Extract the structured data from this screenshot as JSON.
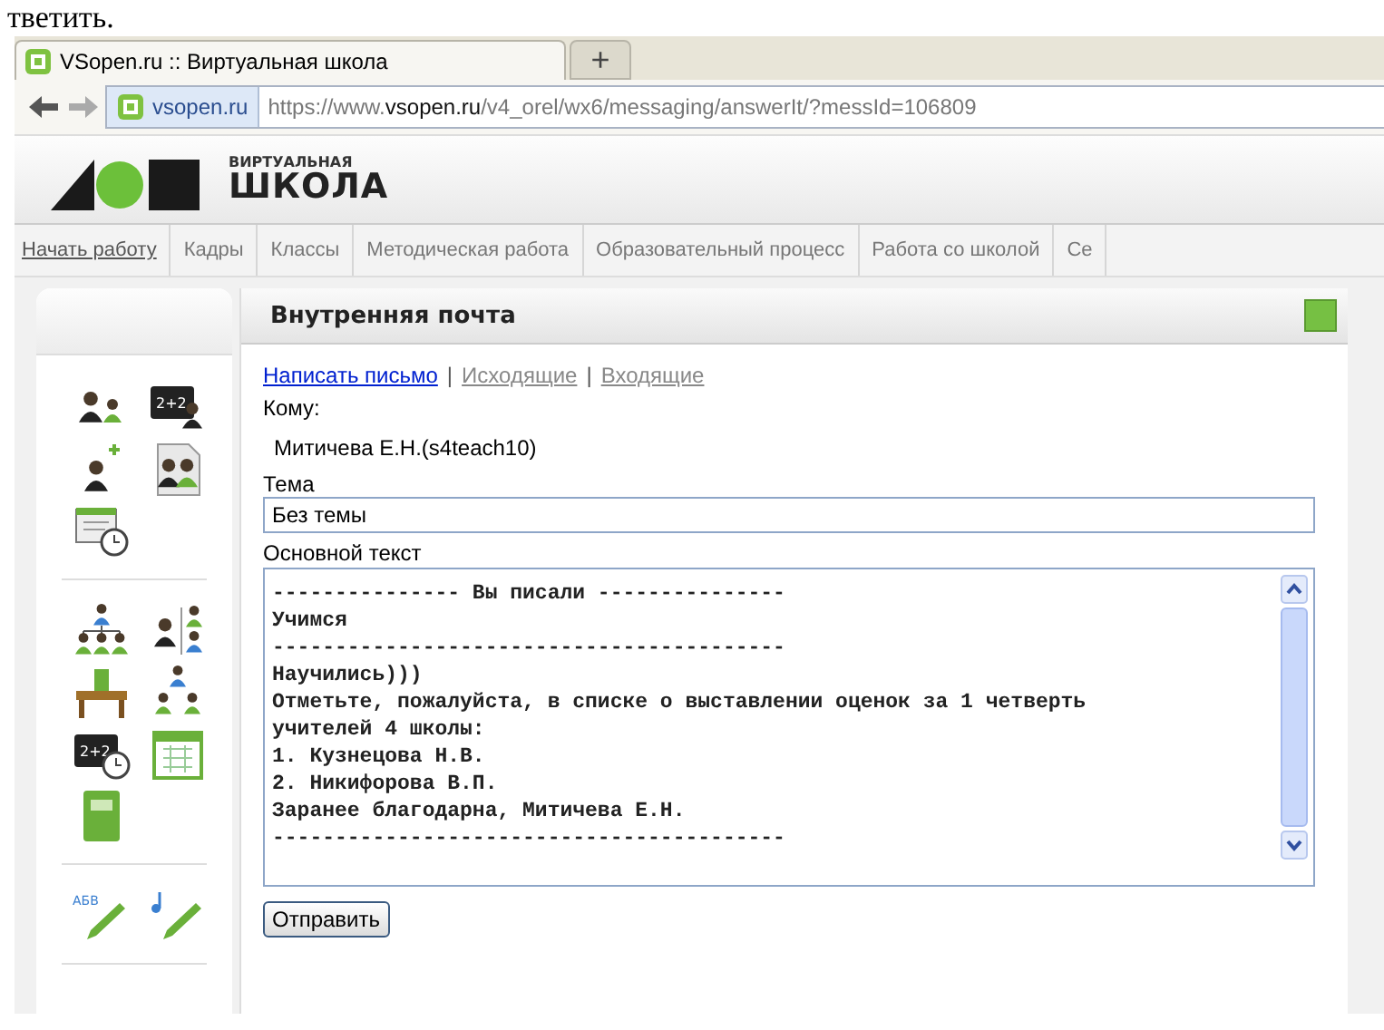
{
  "document_fragment": "тветить.",
  "browser": {
    "tab_title": "VSopen.ru :: Виртуальная школа",
    "new_tab": "+",
    "site_badge": "vsopen.ru",
    "url_prefix": "https://www.",
    "url_domain": "vsopen.ru",
    "url_path": "/v4_orel/wx6/messaging/answerIt/?messId=106809"
  },
  "logo": {
    "small": "ВИРТУАЛЬНАЯ",
    "big": "ШКОЛА"
  },
  "menu": [
    {
      "label": "Начать работу",
      "selected": true
    },
    {
      "label": "Кадры",
      "selected": false
    },
    {
      "label": "Классы",
      "selected": false
    },
    {
      "label": "Методическая работа",
      "selected": false
    },
    {
      "label": "Образовательный процесс",
      "selected": false
    },
    {
      "label": "Работа со школой",
      "selected": false
    },
    {
      "label": "Се",
      "selected": false
    }
  ],
  "sidebar": {
    "groups": [
      [
        [
          {
            "kind": "people"
          },
          {
            "kind": "blackboard-person",
            "label": "2+2"
          }
        ],
        [
          {
            "kind": "person-plus"
          },
          {
            "kind": "document-people"
          }
        ],
        [
          {
            "kind": "presentation-clock"
          }
        ]
      ],
      [
        [
          {
            "kind": "hierarchy"
          },
          {
            "kind": "person-list"
          }
        ],
        [
          {
            "kind": "desk"
          },
          {
            "kind": "group"
          }
        ],
        [
          {
            "kind": "blackboard-clock",
            "label": "2+2"
          },
          {
            "kind": "calendar"
          }
        ],
        [
          {
            "kind": "notebook"
          }
        ]
      ],
      [
        [
          {
            "kind": "pencil",
            "label": "АБВ"
          },
          {
            "kind": "music-pencil"
          }
        ]
      ]
    ]
  },
  "panel": {
    "title": "Внутренняя почта",
    "link_separator": "|",
    "links": [
      {
        "label": "Написать письмо",
        "selected": true
      },
      {
        "label": "Исходящие",
        "selected": false
      },
      {
        "label": "Входящие",
        "selected": false
      }
    ],
    "to_label": "Кому:",
    "to_value": "Митичева Е.Н.(s4teach10)",
    "subject_label": "Тема",
    "subject_value": "Без темы",
    "body_label": "Основной текст",
    "body_lines": [
      "--------------- Вы писали ---------------",
      "Учимся",
      "-----------------------------------------",
      "Научились)))",
      "Отметьте, пожалуйста, в списке о выставлении оценок за 1 четверть",
      "учителей 4 школы:",
      "1. Кузнецова Н.В.",
      "2. Никифорова В.П.",
      "Заранее благодарна, Митичева Е.Н.",
      "-----------------------------------------"
    ],
    "send_button": "Отправить"
  }
}
